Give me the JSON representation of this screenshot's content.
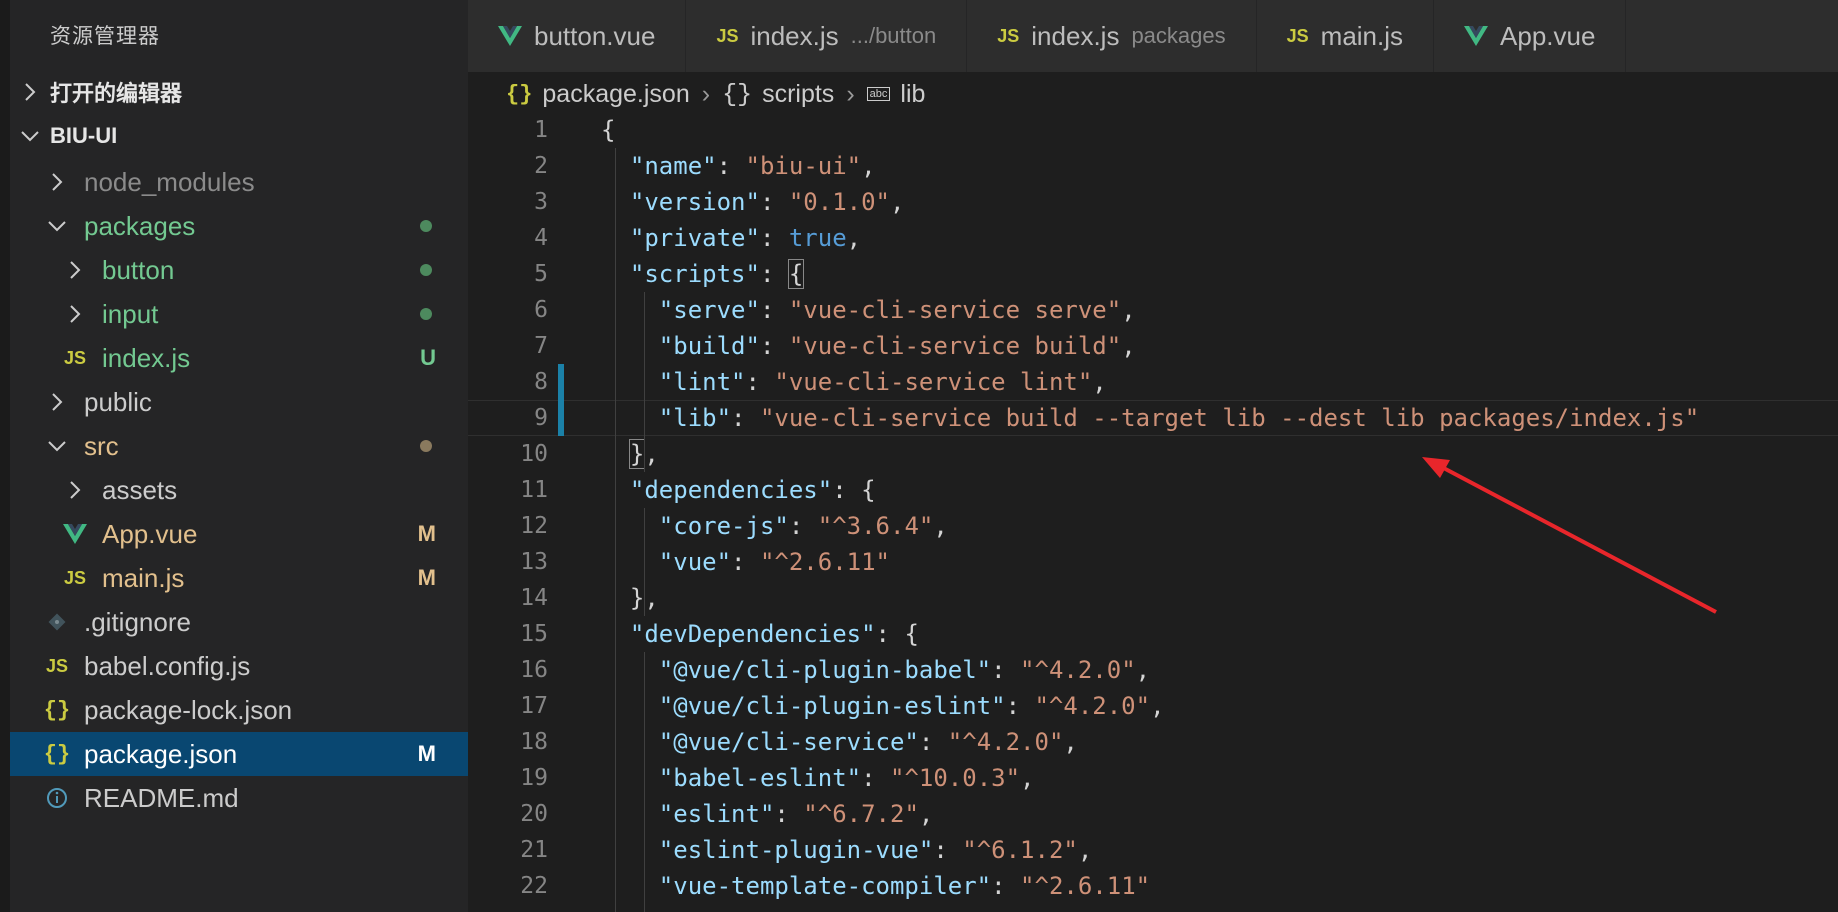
{
  "sidebar": {
    "title": "资源管理器",
    "sections": [
      {
        "label": "打开的编辑器",
        "expanded": false
      },
      {
        "label": "BIU-UI",
        "expanded": true
      }
    ],
    "tree": [
      {
        "label": "node_modules",
        "kind": "folder",
        "expanded": false,
        "color": "#8b8b8b",
        "status": ""
      },
      {
        "label": "packages",
        "kind": "folder",
        "expanded": true,
        "color": "#73c991",
        "status": "dot-green"
      },
      {
        "label": "button",
        "kind": "folder",
        "expanded": false,
        "color": "#73c991",
        "status": "dot-green"
      },
      {
        "label": "input",
        "kind": "folder",
        "expanded": false,
        "color": "#73c991",
        "status": "dot-green"
      },
      {
        "label": "index.js",
        "kind": "js",
        "color": "#73c991",
        "status": "U"
      },
      {
        "label": "public",
        "kind": "folder",
        "expanded": false,
        "color": "#cccccc",
        "status": ""
      },
      {
        "label": "src",
        "kind": "folder",
        "expanded": true,
        "color": "#e2c08d",
        "status": "dot-brown"
      },
      {
        "label": "assets",
        "kind": "folder",
        "expanded": false,
        "color": "#cccccc",
        "status": ""
      },
      {
        "label": "App.vue",
        "kind": "vue",
        "color": "#e2c08d",
        "status": "M"
      },
      {
        "label": "main.js",
        "kind": "js",
        "color": "#e2c08d",
        "status": "M"
      },
      {
        "label": ".gitignore",
        "kind": "git",
        "color": "#cccccc",
        "status": ""
      },
      {
        "label": "babel.config.js",
        "kind": "js",
        "color": "#cccccc",
        "status": ""
      },
      {
        "label": "package-lock.json",
        "kind": "json",
        "color": "#cccccc",
        "status": ""
      },
      {
        "label": "package.json",
        "kind": "json",
        "color": "#ffffff",
        "status": "M",
        "selected": true
      },
      {
        "label": "README.md",
        "kind": "info",
        "color": "#cccccc",
        "status": ""
      }
    ]
  },
  "tabs": [
    {
      "label": "button.vue",
      "kind": "vue",
      "desc": ""
    },
    {
      "label": "index.js",
      "kind": "js",
      "desc": ".../button"
    },
    {
      "label": "index.js",
      "kind": "js",
      "desc": "packages"
    },
    {
      "label": "main.js",
      "kind": "js",
      "desc": ""
    },
    {
      "label": "App.vue",
      "kind": "vue",
      "desc": ""
    }
  ],
  "breadcrumb": {
    "file": "package.json",
    "scripts": "scripts",
    "lib": "lib",
    "abc_glyph": "abc"
  },
  "editor": {
    "current_line": 9,
    "lines": [
      "{",
      "  \"name\": \"biu-ui\",",
      "  \"version\": \"0.1.0\",",
      "  \"private\": true,",
      "  \"scripts\": {",
      "    \"serve\": \"vue-cli-service serve\",",
      "    \"build\": \"vue-cli-service build\",",
      "    \"lint\": \"vue-cli-service lint\",",
      "    \"lib\": \"vue-cli-service build --target lib --dest lib packages/index.js\"",
      "  },",
      "  \"dependencies\": {",
      "    \"core-js\": \"^3.6.4\",",
      "    \"vue\": \"^2.6.11\"",
      "  },",
      "  \"devDependencies\": {",
      "    \"@vue/cli-plugin-babel\": \"^4.2.0\",",
      "    \"@vue/cli-plugin-eslint\": \"^4.2.0\",",
      "    \"@vue/cli-service\": \"^4.2.0\",",
      "    \"babel-eslint\": \"^10.0.3\",",
      "    \"eslint\": \"^6.7.2\",",
      "    \"eslint-plugin-vue\": \"^6.1.2\",",
      "    \"vue-template-compiler\": \"^2.6.11\""
    ]
  },
  "colors": {
    "accent_blue": "#094771",
    "annotation_red": "#e8262b",
    "js_yellow": "#cbcb41",
    "vue_green": "#41b883",
    "git_added": "#73c991",
    "git_modified": "#e2c08d"
  }
}
